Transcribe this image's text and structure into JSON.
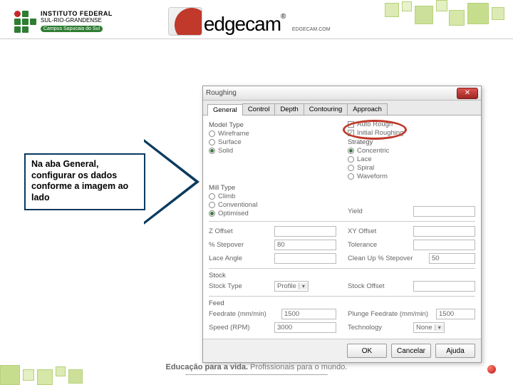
{
  "header": {
    "if_line1": "INSTITUTO FEDERAL",
    "if_line2": "SUL-RIO-GRANDENSE",
    "if_campus": "Campus Sapucaia do Sul",
    "edge_text": "edgecam",
    "edge_com": "EDGECAM.COM"
  },
  "instruction": "Na aba General, configurar os dados conforme a imagem ao lado",
  "dialog": {
    "title": "Roughing",
    "tabs": [
      "General",
      "Control",
      "Depth",
      "Contouring",
      "Approach"
    ],
    "model_type_label": "Model Type",
    "model_type_opts": [
      "Wireframe",
      "Surface",
      "Solid"
    ],
    "model_type_sel": 2,
    "check1": "Auto Rough",
    "check2": "Initial Roughing",
    "strategy_label": "Strategy",
    "strategy_opts": [
      "Concentric",
      "Lace",
      "Spiral",
      "Waveform"
    ],
    "strategy_sel": 0,
    "mill_label": "Mill Type",
    "mill_opts": [
      "Climb",
      "Conventional",
      "Optimised"
    ],
    "mill_sel": 2,
    "yield_label": "Yield",
    "z_offset_label": "Z Offset",
    "xy_offset_label": "XY Offset",
    "stepover_label": "% Stepover",
    "stepover_val": "80",
    "tolerance_label": "Tolerance",
    "lace_angle_label": "Lace Angle",
    "cleanup_label": "Clean Up % Stepover",
    "cleanup_val": "50",
    "stock_label": "Stock",
    "stock_type_label": "Stock Type",
    "stock_type_val": "Profile",
    "stock_offset_label": "Stock Offset",
    "feed_label": "Feed",
    "feedrate_label": "Feedrate (mm/min)",
    "feedrate_val": "1500",
    "plunge_label": "Plunge Feedrate (mm/min)",
    "plunge_val": "1500",
    "speed_label": "Speed (RPM)",
    "speed_val": "3000",
    "tech_label": "Technology",
    "tech_val": "None",
    "ok": "OK",
    "cancel": "Cancelar",
    "help": "Ajuda"
  },
  "footer": {
    "l1a": "Educação para a vida.",
    "l1b": " Profissionais para o mundo."
  }
}
